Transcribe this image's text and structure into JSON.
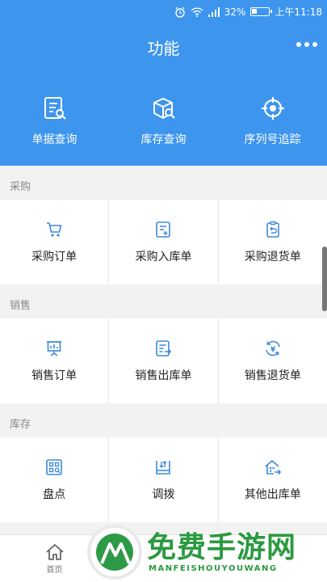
{
  "status_bar": {
    "battery": "32%",
    "time": "上午11:18",
    "battery_level": 0.32
  },
  "header": {
    "title": "功能",
    "quick_actions": [
      {
        "label": "单据查询",
        "icon": "document-search-icon"
      },
      {
        "label": "库存查询",
        "icon": "box-search-icon"
      },
      {
        "label": "序列号追踪",
        "icon": "target-icon"
      }
    ]
  },
  "sections": [
    {
      "label": "采购",
      "items": [
        {
          "label": "采购订单",
          "icon": "cart-icon"
        },
        {
          "label": "采购入库单",
          "icon": "document-add-icon"
        },
        {
          "label": "采购退货单",
          "icon": "clipboard-return-icon"
        }
      ]
    },
    {
      "label": "销售",
      "items": [
        {
          "label": "销售订单",
          "icon": "presentation-board-icon"
        },
        {
          "label": "销售出库单",
          "icon": "document-out-icon"
        },
        {
          "label": "销售退货单",
          "icon": "yen-refresh-icon"
        }
      ]
    },
    {
      "label": "库存",
      "items": [
        {
          "label": "盘点",
          "icon": "inventory-check-icon"
        },
        {
          "label": "调拨",
          "icon": "transfer-icon"
        },
        {
          "label": "其他出库单",
          "icon": "house-out-icon"
        }
      ]
    }
  ],
  "tabbar": [
    {
      "label": "首页",
      "icon": "home-icon"
    }
  ],
  "watermark": {
    "text": "免费手游网",
    "sub": "MANFEISHOUYOUWANG"
  },
  "colors": {
    "primary": "#3d95ee",
    "icon": "#3d8ad8",
    "watermark": "#2b9a41"
  }
}
